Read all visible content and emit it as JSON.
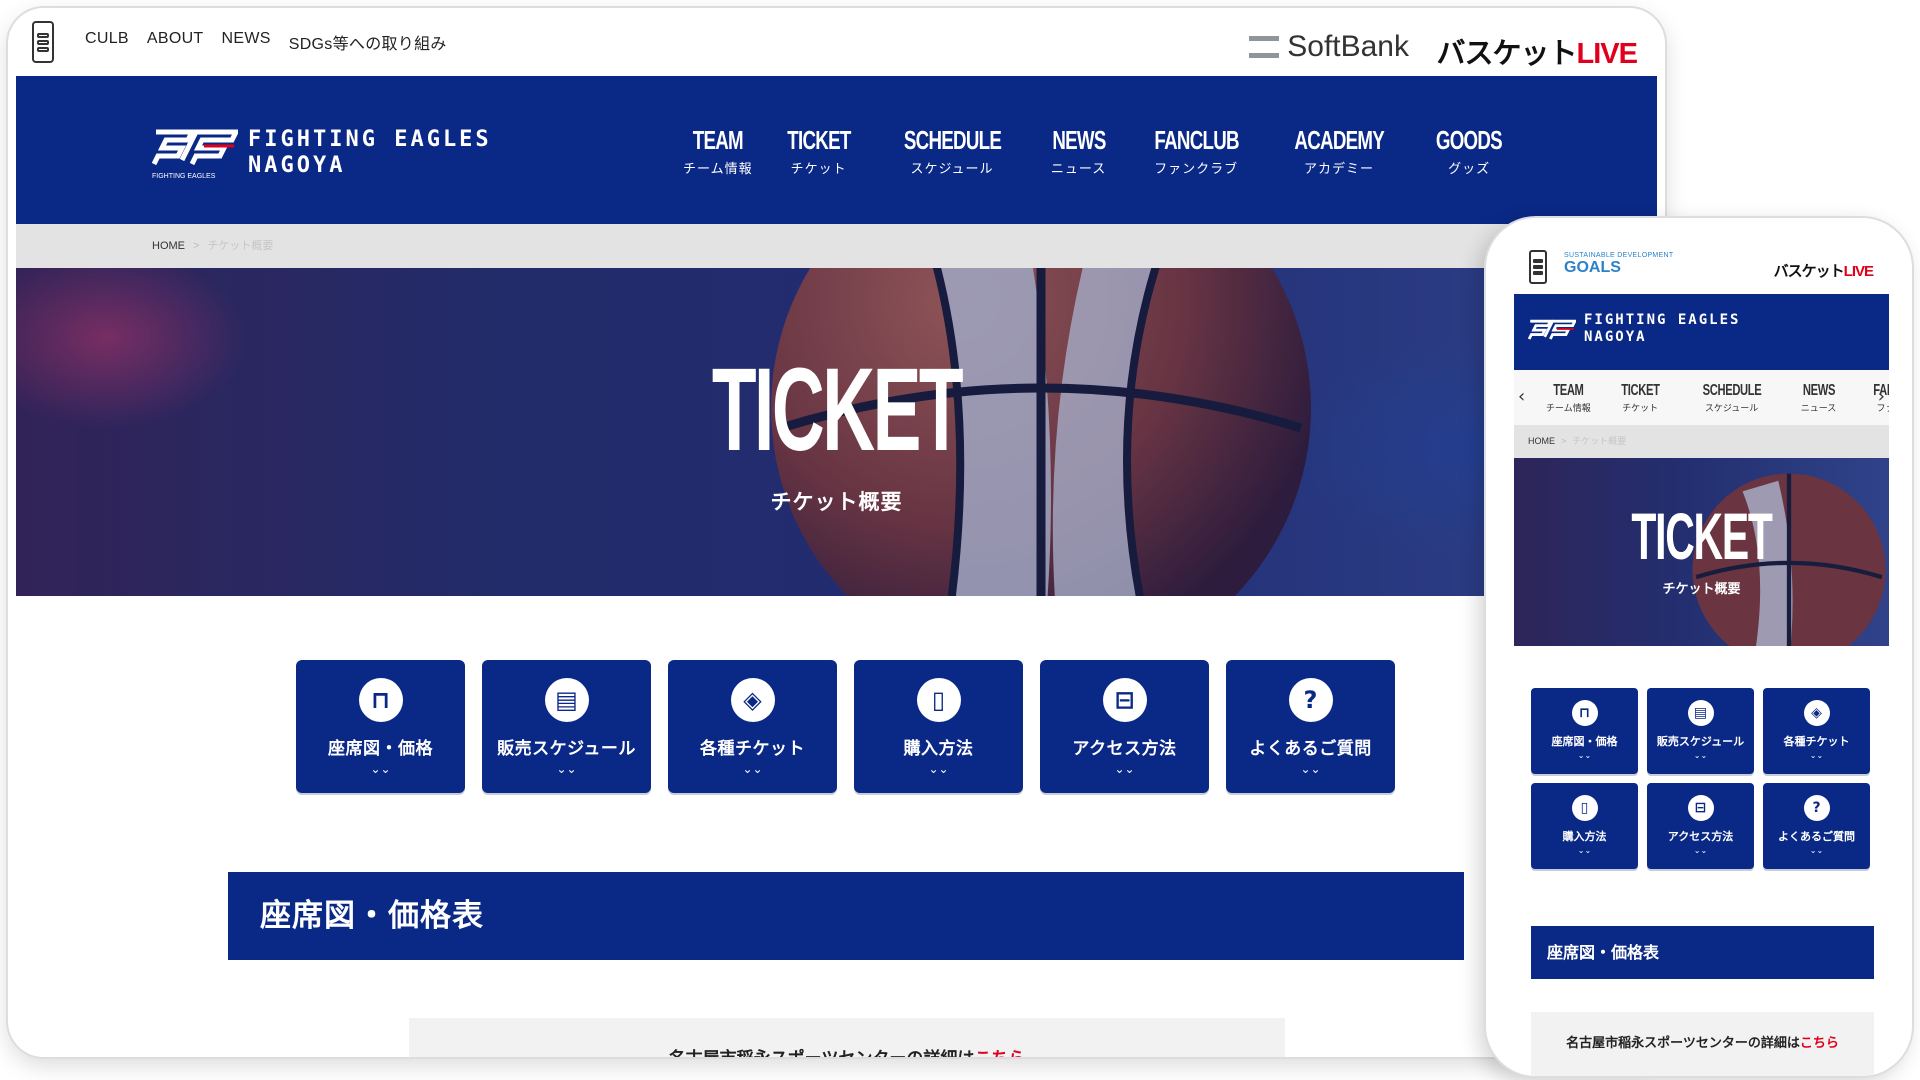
{
  "desktop": {
    "topnav": [
      "CULB",
      "ABOUT",
      "NEWS",
      "SDGs等への取り組み"
    ],
    "sponsor": "SoftBank",
    "basket_live": {
      "main": "バスケット",
      "accent": "LIVE"
    },
    "team_name": {
      "line1": "FIGHTING EAGLES",
      "line2": "NAGOYA",
      "mark": "FIGHTING EAGLES"
    },
    "mainnav": [
      {
        "en": "TEAM",
        "ja": "チーム情報"
      },
      {
        "en": "TICKET",
        "ja": "チケット"
      },
      {
        "en": "SCHEDULE",
        "ja": "スケジュール"
      },
      {
        "en": "NEWS",
        "ja": "ニュース"
      },
      {
        "en": "FANCLUB",
        "ja": "ファンクラブ"
      },
      {
        "en": "ACADEMY",
        "ja": "アカデミー"
      },
      {
        "en": "GOODS",
        "ja": "グッズ"
      }
    ],
    "breadcrumb": {
      "home": "HOME",
      "separator": ">",
      "current": "チケット概要"
    },
    "hero": {
      "title": "TICKET",
      "subtitle": "チケット概要"
    },
    "tiles": [
      {
        "label": "座席図・価格",
        "icon": "seat-icon",
        "glyph": "⊓"
      },
      {
        "label": "販売スケジュール",
        "icon": "calendar-icon",
        "glyph": "▤"
      },
      {
        "label": "各種チケット",
        "icon": "ticket-icon",
        "glyph": "◈"
      },
      {
        "label": "購入方法",
        "icon": "smartphone-icon",
        "glyph": "▯"
      },
      {
        "label": "アクセス方法",
        "icon": "train-icon",
        "glyph": "⊟"
      },
      {
        "label": "よくあるご質問",
        "icon": "question-icon",
        "glyph": "?"
      }
    ],
    "chevron": "⌄⌄",
    "section_title": "座席図・価格表",
    "info": {
      "text": "名古屋市稲永スポーツセンターの詳細は",
      "link": "こちら"
    }
  },
  "mobile": {
    "sdgs": {
      "top": "SUSTAINABLE DEVELOPMENT",
      "main": "GOALS"
    },
    "nav": [
      {
        "en": "TEAM",
        "ja": "チーム情報"
      },
      {
        "en": "TICKET",
        "ja": "チケット"
      },
      {
        "en": "SCHEDULE",
        "ja": "スケジュール"
      },
      {
        "en": "NEWS",
        "ja": "ニュース"
      },
      {
        "en": "FANCLU",
        "ja": "ファンク"
      }
    ],
    "arrows": {
      "left": "‹",
      "right": "›"
    }
  },
  "colors": {
    "brand_navy": "#0a2886",
    "accent_red": "#e0001b",
    "breadcrumb_bg": "#e3e3e3"
  }
}
